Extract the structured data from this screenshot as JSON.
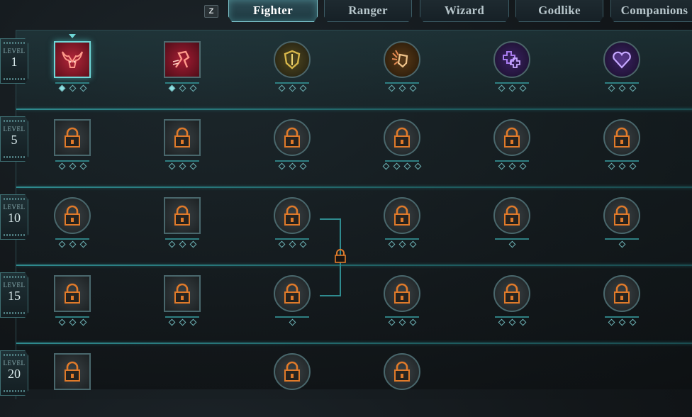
{
  "tabs": {
    "hotkey": "Z",
    "items": [
      {
        "label": "Fighter",
        "active": true
      },
      {
        "label": "Ranger",
        "active": false
      },
      {
        "label": "Wizard",
        "active": false
      },
      {
        "label": "Godlike",
        "active": false
      },
      {
        "label": "Companions",
        "active": false
      }
    ]
  },
  "levels": [
    {
      "word": "LEVEL",
      "num": "1"
    },
    {
      "word": "LEVEL",
      "num": "5"
    },
    {
      "word": "LEVEL",
      "num": "10"
    },
    {
      "word": "LEVEL",
      "num": "15"
    },
    {
      "word": "LEVEL",
      "num": "20"
    }
  ],
  "colors": {
    "accent": "#6fd7d7",
    "lock": "#e07a2a",
    "row_line": "#2f8b8f",
    "active_tab_text": "#ffffff"
  },
  "abilities": [
    [
      {
        "shape": "square",
        "state": "unlocked",
        "icon": "bull-head-icon",
        "pips": 3,
        "filled": 1,
        "selected": true
      },
      {
        "shape": "square",
        "state": "available",
        "icon": "charging-figure-icon",
        "pips": 3,
        "filled": 1
      },
      {
        "shape": "round",
        "state": "available",
        "icon": "golden-shield-icon",
        "pips": 3,
        "filled": 0
      },
      {
        "shape": "round",
        "state": "available",
        "icon": "shield-burst-icon",
        "pips": 3,
        "filled": 0
      },
      {
        "shape": "round",
        "state": "available",
        "icon": "purple-crosses-icon",
        "pips": 3,
        "filled": 0
      },
      {
        "shape": "round",
        "state": "available",
        "icon": "purple-heart-icon",
        "pips": 3,
        "filled": 0
      }
    ],
    [
      {
        "shape": "square",
        "state": "locked",
        "icon": "lock-icon",
        "pips": 3,
        "filled": 0
      },
      {
        "shape": "square",
        "state": "locked",
        "icon": "lock-icon",
        "pips": 3,
        "filled": 0
      },
      {
        "shape": "round",
        "state": "locked",
        "icon": "lock-icon",
        "pips": 3,
        "filled": 0
      },
      {
        "shape": "round",
        "state": "locked",
        "icon": "lock-icon",
        "pips": 4,
        "filled": 0
      },
      {
        "shape": "round",
        "state": "locked",
        "icon": "lock-icon",
        "pips": 3,
        "filled": 0
      },
      {
        "shape": "round",
        "state": "locked",
        "icon": "lock-icon",
        "pips": 3,
        "filled": 0
      }
    ],
    [
      {
        "shape": "round",
        "state": "locked",
        "icon": "lock-icon",
        "pips": 3,
        "filled": 0
      },
      {
        "shape": "square",
        "state": "locked",
        "icon": "lock-icon",
        "pips": 3,
        "filled": 0
      },
      {
        "shape": "round",
        "state": "locked",
        "icon": "lock-icon",
        "pips": 3,
        "filled": 0
      },
      {
        "shape": "round",
        "state": "locked",
        "icon": "lock-icon",
        "pips": 3,
        "filled": 0
      },
      {
        "shape": "round",
        "state": "locked",
        "icon": "lock-icon",
        "pips": 1,
        "filled": 0
      },
      {
        "shape": "round",
        "state": "locked",
        "icon": "lock-icon",
        "pips": 1,
        "filled": 0
      }
    ],
    [
      {
        "shape": "square",
        "state": "locked",
        "icon": "lock-icon",
        "pips": 3,
        "filled": 0
      },
      {
        "shape": "square",
        "state": "locked",
        "icon": "lock-icon",
        "pips": 3,
        "filled": 0
      },
      {
        "shape": "round",
        "state": "locked",
        "icon": "lock-icon",
        "pips": 1,
        "filled": 0
      },
      {
        "shape": "round",
        "state": "locked",
        "icon": "lock-icon",
        "pips": 3,
        "filled": 0
      },
      {
        "shape": "round",
        "state": "locked",
        "icon": "lock-icon",
        "pips": 3,
        "filled": 0
      },
      {
        "shape": "round",
        "state": "locked",
        "icon": "lock-icon",
        "pips": 3,
        "filled": 0
      }
    ],
    [
      {
        "shape": "square",
        "state": "locked",
        "icon": "lock-icon",
        "pips": 0,
        "filled": 0
      },
      null,
      {
        "shape": "round",
        "state": "locked",
        "icon": "lock-icon",
        "pips": 0,
        "filled": 0
      },
      {
        "shape": "round",
        "state": "locked",
        "icon": "lock-icon",
        "pips": 0,
        "filled": 0
      },
      null,
      null
    ]
  ]
}
